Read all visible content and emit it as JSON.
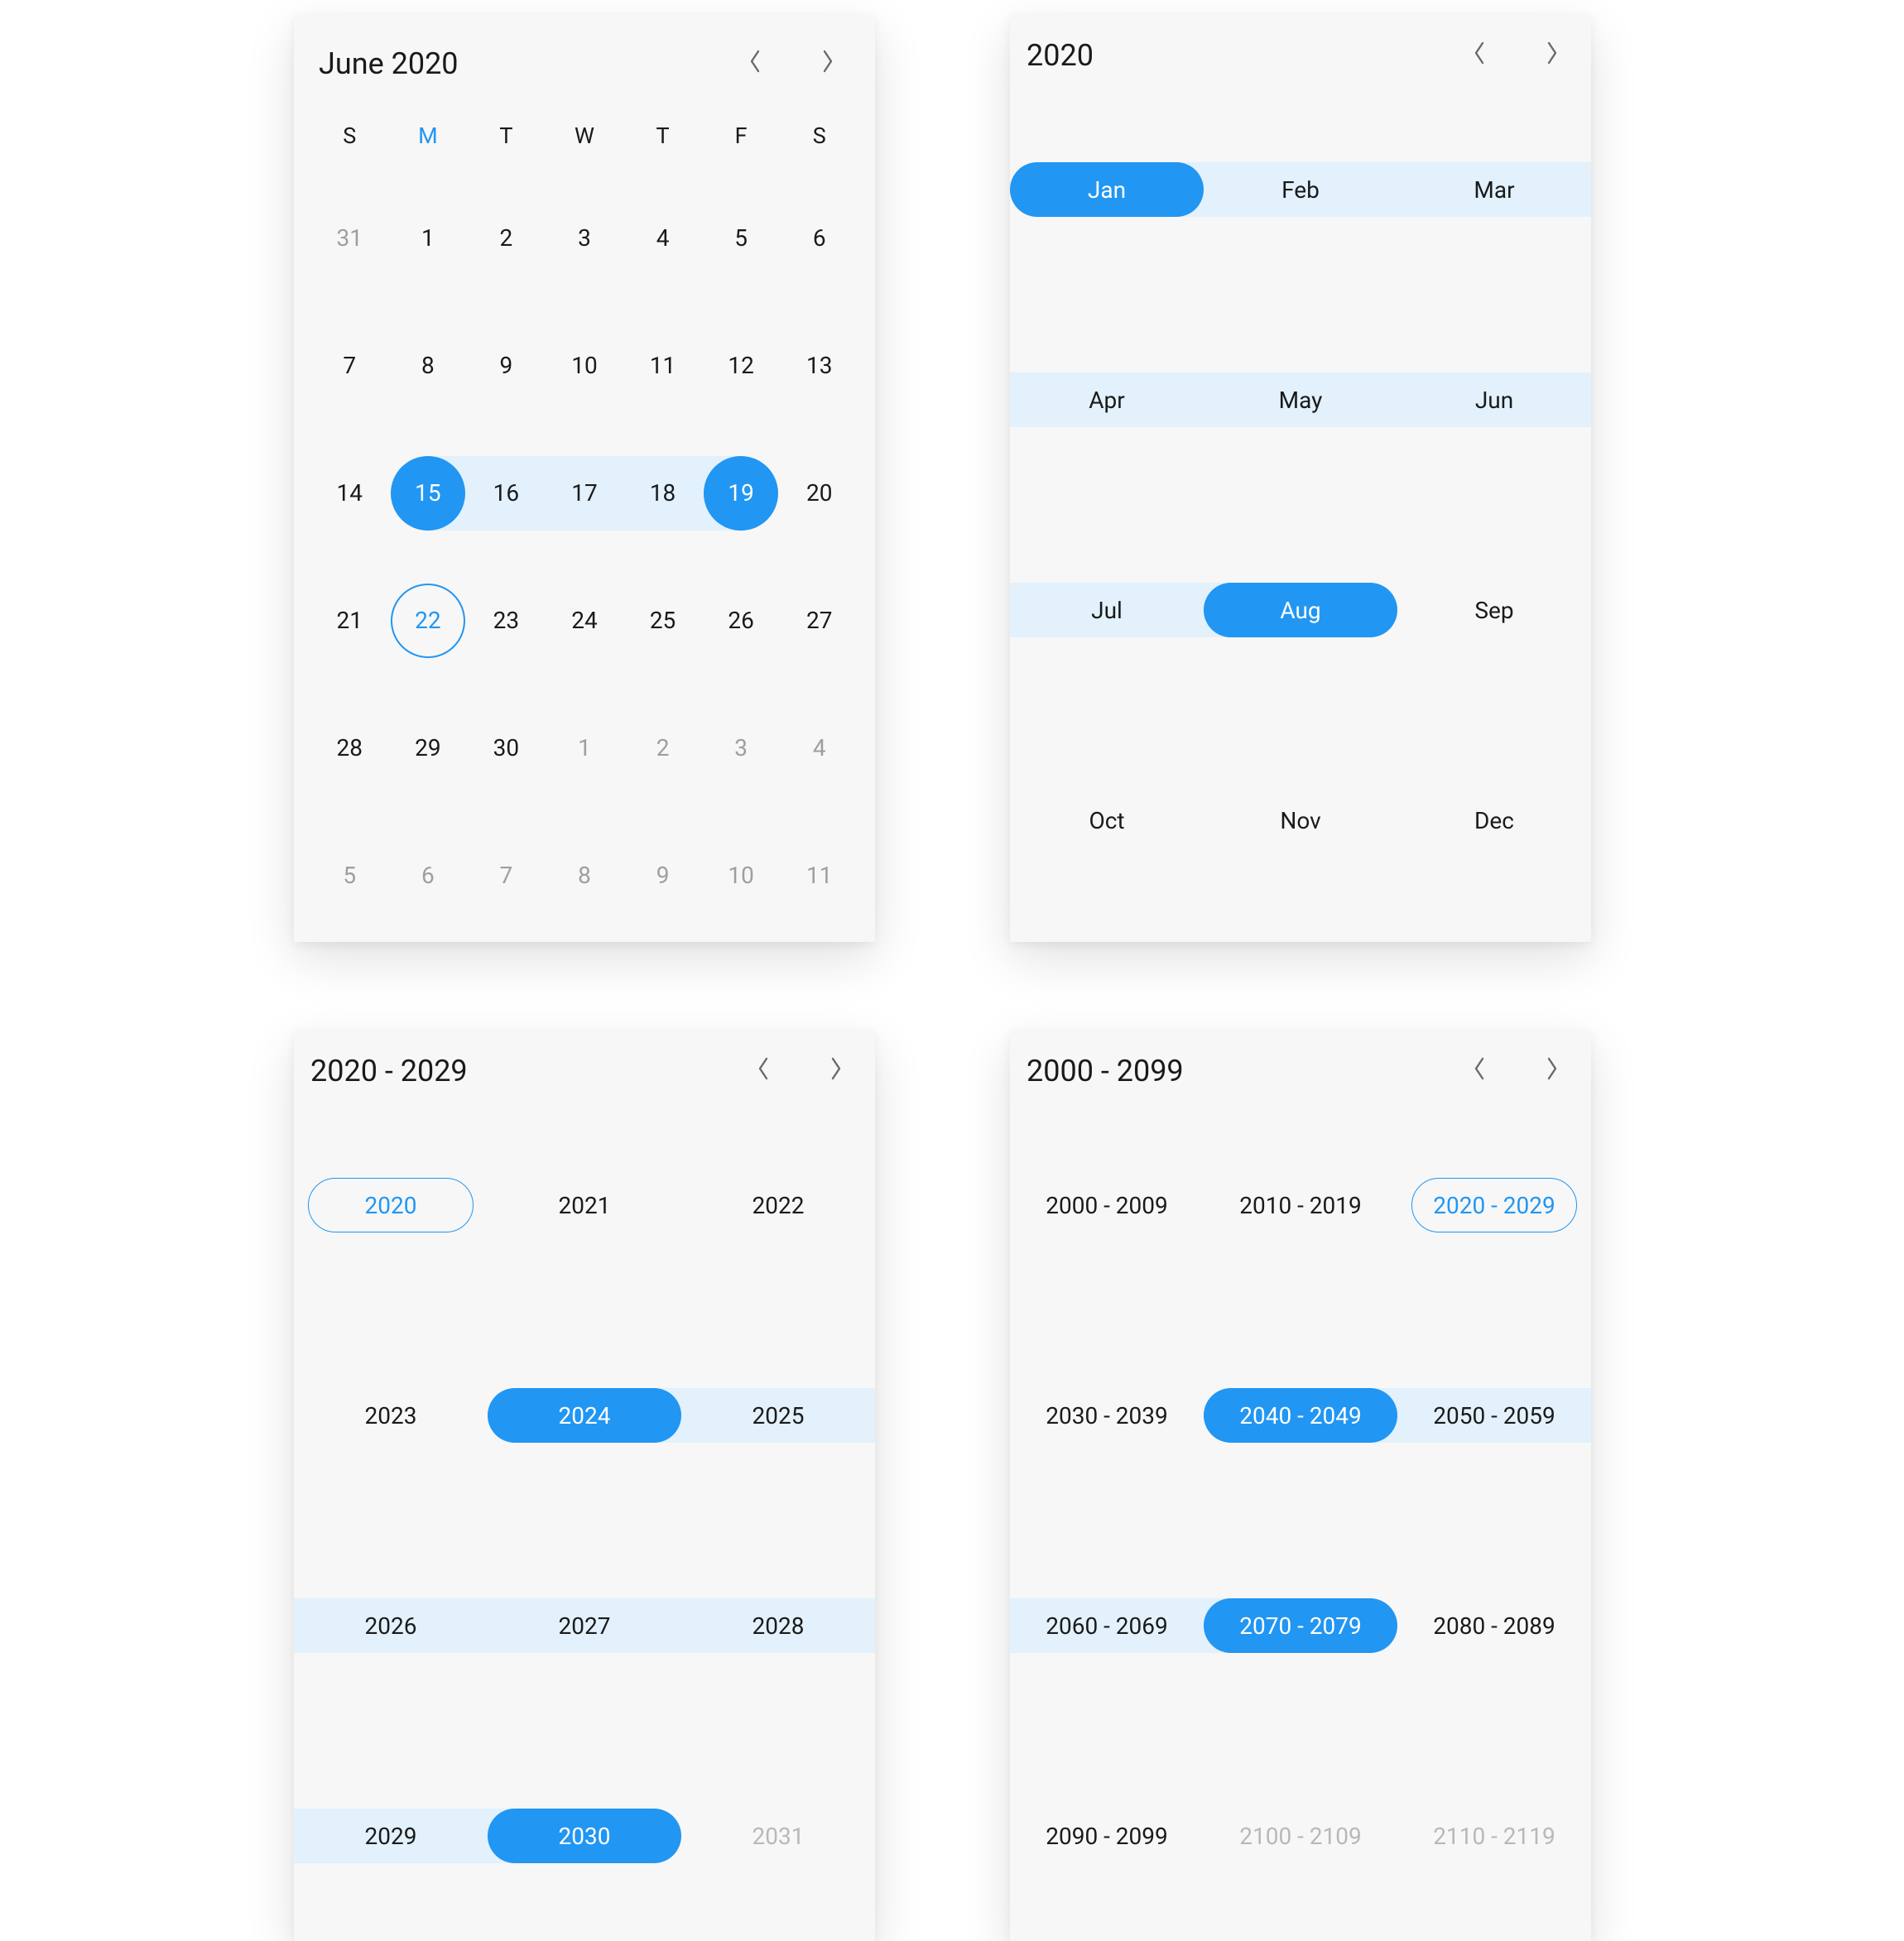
{
  "colors": {
    "accent": "#2196f3",
    "rangeFill": "#e2f1fc",
    "muted": "#9e9e9e",
    "bg": "#f7f7f7"
  },
  "calendar": {
    "title": "June 2020",
    "dayHeaders": [
      "S",
      "M",
      "T",
      "W",
      "T",
      "F",
      "S"
    ],
    "accentDayHeaderIndex": 1,
    "weeks": [
      [
        {
          "n": "31",
          "muted": true
        },
        {
          "n": "1"
        },
        {
          "n": "2"
        },
        {
          "n": "3"
        },
        {
          "n": "4"
        },
        {
          "n": "5"
        },
        {
          "n": "6"
        }
      ],
      [
        {
          "n": "7"
        },
        {
          "n": "8"
        },
        {
          "n": "9"
        },
        {
          "n": "10"
        },
        {
          "n": "11"
        },
        {
          "n": "12"
        },
        {
          "n": "13"
        }
      ],
      [
        {
          "n": "14"
        },
        {
          "n": "15",
          "selStart": true
        },
        {
          "n": "16",
          "inRange": true
        },
        {
          "n": "17",
          "inRange": true
        },
        {
          "n": "18",
          "inRange": true
        },
        {
          "n": "19",
          "selEnd": true
        },
        {
          "n": "20"
        }
      ],
      [
        {
          "n": "21"
        },
        {
          "n": "22",
          "today": true
        },
        {
          "n": "23"
        },
        {
          "n": "24"
        },
        {
          "n": "25"
        },
        {
          "n": "26"
        },
        {
          "n": "27"
        }
      ],
      [
        {
          "n": "28"
        },
        {
          "n": "29"
        },
        {
          "n": "30"
        },
        {
          "n": "1",
          "muted": true
        },
        {
          "n": "2",
          "muted": true
        },
        {
          "n": "3",
          "muted": true
        },
        {
          "n": "4",
          "muted": true
        }
      ],
      [
        {
          "n": "5",
          "muted": true
        },
        {
          "n": "6",
          "muted": true
        },
        {
          "n": "7",
          "muted": true
        },
        {
          "n": "8",
          "muted": true
        },
        {
          "n": "9",
          "muted": true
        },
        {
          "n": "10",
          "muted": true
        },
        {
          "n": "11",
          "muted": true
        }
      ]
    ]
  },
  "monthPicker": {
    "title": "2020",
    "cells": [
      {
        "label": "Jan",
        "selStart": true
      },
      {
        "label": "Feb",
        "inRange": true
      },
      {
        "label": "Mar",
        "inRange": true,
        "edgeRight": true
      },
      {
        "label": "Apr",
        "inRange": true,
        "edgeLeft": true
      },
      {
        "label": "May",
        "inRange": true
      },
      {
        "label": "Jun",
        "inRange": true,
        "edgeRight": true
      },
      {
        "label": "Jul",
        "inRange": true,
        "edgeLeft": true
      },
      {
        "label": "Aug",
        "selEnd": true
      },
      {
        "label": "Sep"
      },
      {
        "label": "Oct"
      },
      {
        "label": "Nov"
      },
      {
        "label": "Dec"
      }
    ]
  },
  "yearPicker": {
    "title": "2020 - 2029",
    "cells": [
      {
        "label": "2020",
        "todayOutline": true
      },
      {
        "label": "2021"
      },
      {
        "label": "2022"
      },
      {
        "label": "2023"
      },
      {
        "label": "2024",
        "selStart": true
      },
      {
        "label": "2025",
        "inRange": true,
        "edgeRight": true
      },
      {
        "label": "2026",
        "inRange": true,
        "edgeLeft": true
      },
      {
        "label": "2027",
        "inRange": true
      },
      {
        "label": "2028",
        "inRange": true,
        "edgeRight": true
      },
      {
        "label": "2029",
        "inRange": true,
        "edgeLeft": true
      },
      {
        "label": "2030",
        "selEnd": true
      },
      {
        "label": "2031",
        "muted": true
      }
    ]
  },
  "decadePicker": {
    "title": "2000 - 2099",
    "cells": [
      {
        "label": "2000 - 2009"
      },
      {
        "label": "2010 - 2019"
      },
      {
        "label": "2020 - 2029",
        "todayOutline": true
      },
      {
        "label": "2030 - 2039"
      },
      {
        "label": "2040 - 2049",
        "selStart": true
      },
      {
        "label": "2050 - 2059",
        "inRange": true,
        "edgeRight": true
      },
      {
        "label": "2060 - 2069",
        "inRange": true,
        "edgeLeft": true
      },
      {
        "label": "2070 - 2079",
        "selEnd": true
      },
      {
        "label": "2080 - 2089"
      },
      {
        "label": "2090 - 2099"
      },
      {
        "label": "2100 - 2109",
        "muted": true
      },
      {
        "label": "2110 - 2119",
        "muted": true
      }
    ]
  }
}
